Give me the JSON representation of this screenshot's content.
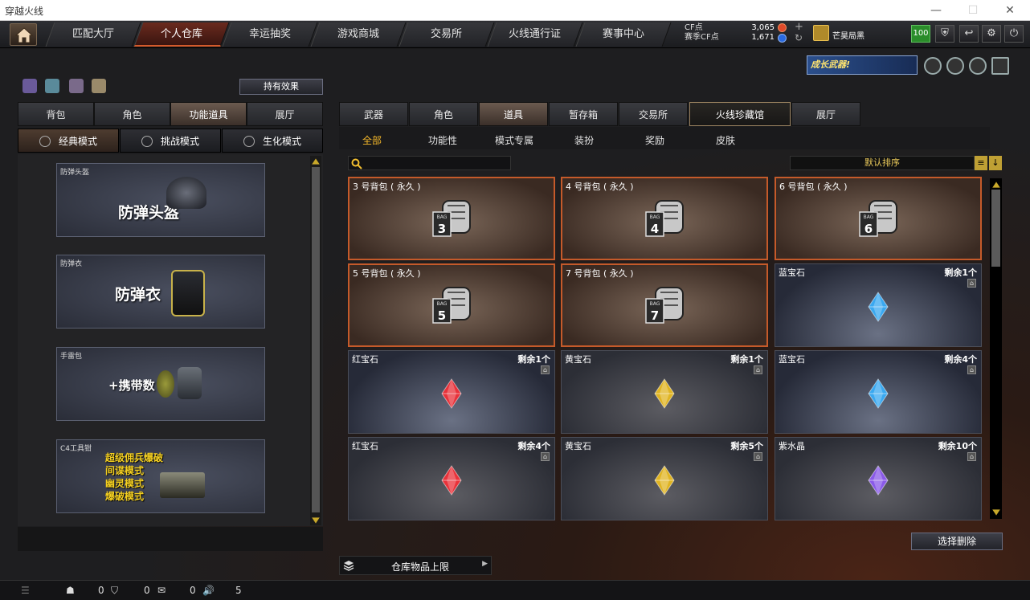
{
  "window": {
    "title": "穿越火线",
    "min": "—",
    "max": "☐",
    "close": "✕"
  },
  "nav": {
    "tabs": [
      {
        "label": "匹配大厅"
      },
      {
        "label": "个人仓库"
      },
      {
        "label": "幸运抽奖"
      },
      {
        "label": "游戏商城"
      },
      {
        "label": "交易所"
      },
      {
        "label": "火线通行证"
      },
      {
        "label": "赛事中心"
      }
    ],
    "cf_label": "CF点",
    "cf_value": "3,065",
    "season_cf_label": "赛季CF点",
    "season_cf_value": "1,671",
    "plus": "+",
    "refresh": "↻",
    "username": "芒昊局黑",
    "level": "100"
  },
  "promo": {
    "banner": "成长武器!"
  },
  "left": {
    "hold_effect": "持有效果",
    "tabs": [
      {
        "label": "背包"
      },
      {
        "label": "角色"
      },
      {
        "label": "功能道具"
      },
      {
        "label": "展厅"
      }
    ],
    "modes": [
      {
        "label": "经典模式"
      },
      {
        "label": "挑战模式"
      },
      {
        "label": "生化模式"
      }
    ],
    "cards": [
      {
        "caption": "防弹头盔",
        "title": "防弹头盔"
      },
      {
        "caption": "防弹衣",
        "title": "防弹衣"
      },
      {
        "caption": "手雷包",
        "title": "+携带数"
      },
      {
        "caption": "C4工具钳",
        "lines": [
          "超级佣兵爆破",
          "间谍模式",
          "幽灵模式",
          "爆破模式"
        ]
      }
    ]
  },
  "right": {
    "tabs": [
      {
        "label": "武器"
      },
      {
        "label": "角色"
      },
      {
        "label": "道具"
      },
      {
        "label": "暂存箱"
      },
      {
        "label": "交易所"
      },
      {
        "label": "火线珍藏馆"
      },
      {
        "label": "展厅"
      }
    ],
    "subtabs": [
      {
        "label": "全部"
      },
      {
        "label": "功能性"
      },
      {
        "label": "模式专属"
      },
      {
        "label": "装扮"
      },
      {
        "label": "奖励"
      },
      {
        "label": "皮肤"
      }
    ],
    "search_placeholder": "",
    "sort_label": "默认排序",
    "items": [
      {
        "name": "3 号背包 ( 永久 )",
        "kind": "bag",
        "num": "3"
      },
      {
        "name": "4 号背包 ( 永久 )",
        "kind": "bag",
        "num": "4"
      },
      {
        "name": "6 号背包 ( 永久 )",
        "kind": "bag",
        "num": "6"
      },
      {
        "name": "5 号背包 ( 永久 )",
        "kind": "bag",
        "num": "5"
      },
      {
        "name": "7 号背包 ( 永久 )",
        "kind": "bag",
        "num": "7"
      },
      {
        "name": "蓝宝石",
        "remain": "剩余1个",
        "kind": "gem",
        "color": "#3aa8f0"
      },
      {
        "name": "红宝石",
        "remain": "剩余1个",
        "kind": "gem",
        "color": "#e8323a"
      },
      {
        "name": "黄宝石",
        "remain": "剩余1个",
        "kind": "gem",
        "color": "#e0b422"
      },
      {
        "name": "蓝宝石",
        "remain": "剩余4个",
        "kind": "gem",
        "color": "#3aa8f0"
      },
      {
        "name": "红宝石",
        "remain": "剩余4个",
        "kind": "gem",
        "color": "#e8323a"
      },
      {
        "name": "黄宝石",
        "remain": "剩余5个",
        "kind": "gem",
        "color": "#e0b422"
      },
      {
        "name": "紫水晶",
        "remain": "剩余10个",
        "kind": "gem",
        "color": "#8a5ae8"
      }
    ],
    "bag_tag": "BAG",
    "delete_selected": "选择删除",
    "storage_limit": "仓库物品上限"
  },
  "status": {
    "a": "0",
    "b": "0",
    "c": "0",
    "d": "5"
  }
}
